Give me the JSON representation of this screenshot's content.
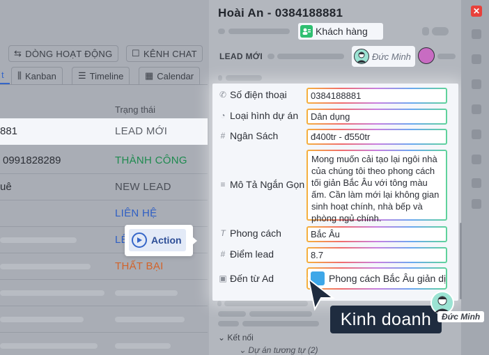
{
  "background": {
    "actions": [
      {
        "label": "DÒNG HOẠT ĐỘNG",
        "icon": "activity-icon"
      },
      {
        "label": "KÊNH CHAT",
        "icon": "chat-icon"
      }
    ],
    "tabs": [
      {
        "label": "t",
        "icon": ""
      },
      {
        "label": "Kanban",
        "icon": "kanban-icon"
      },
      {
        "label": "Timeline",
        "icon": "timeline-icon"
      },
      {
        "label": "Calendar",
        "icon": "calendar-icon"
      }
    ],
    "column_header": "Trạng thái",
    "rows": [
      {
        "phone": "881",
        "status": "LEAD MỚI",
        "color": "#5c6068"
      },
      {
        "phone": "0991828289",
        "status": "THÀNH CÔNG",
        "color": "#1e8a4f"
      },
      {
        "phone": "uê",
        "status": "NEW LEAD",
        "color": "#4a4e57"
      },
      {
        "phone": "",
        "status": "LIÊN HỆ",
        "color": "#2f5fc4"
      },
      {
        "phone": "",
        "status": "LÊ",
        "color": "#2f5fc4"
      },
      {
        "phone": "",
        "status": "THẤT BẠI",
        "color": "#d2632a"
      }
    ]
  },
  "panel": {
    "title": "Hoài An - 0384188881",
    "customer_chip": "Khách hàng",
    "status_label": "LEAD MỚI",
    "owner_name": "Đức Minh",
    "fields": [
      {
        "icon": "phone-icon",
        "glyph": "✆",
        "label": "Số điện thoại",
        "value": "0384188881"
      },
      {
        "icon": "circle-check-icon",
        "glyph": "◔",
        "label": "Loại hình dự án",
        "value": "Dân dụng"
      },
      {
        "icon": "hash-icon",
        "glyph": "#",
        "label": "Ngân Sách",
        "value": "đ400tr - đ550tr"
      },
      {
        "icon": "text-icon",
        "glyph": "≡",
        "label": "Mô Tả Ngắn Gọn",
        "value": "Mong muốn cải tạo lại ngôi nhà của chúng tôi theo phong cách tối giản Bắc Âu với tông màu ấm. Cần làm mới lại không gian sinh hoạt chính, nhà bếp và phòng ngủ chính."
      },
      {
        "icon": "italic-t-icon",
        "glyph": "T",
        "label": "Phong cách",
        "value": "Bắc Âu"
      },
      {
        "icon": "hash-icon",
        "glyph": "#",
        "label": "Điểm lead",
        "value": "8.7"
      },
      {
        "icon": "ad-icon",
        "glyph": "▣",
        "label": "Đến từ Ad",
        "value": "Phong cách Bắc Âu giản dị"
      }
    ],
    "connections_label": "Kết nối",
    "similar_projects": "Dự án tương tự (2)"
  },
  "overlay": {
    "action_label": "Action",
    "badge_label": "Kinh doanh",
    "cursor_user": "Đức Minh"
  },
  "colors": {
    "accent": "#3566c8",
    "success": "#1e8a4f",
    "danger": "#d2632a",
    "close": "#e8413b",
    "badge_bg": "#1f2c3f"
  }
}
